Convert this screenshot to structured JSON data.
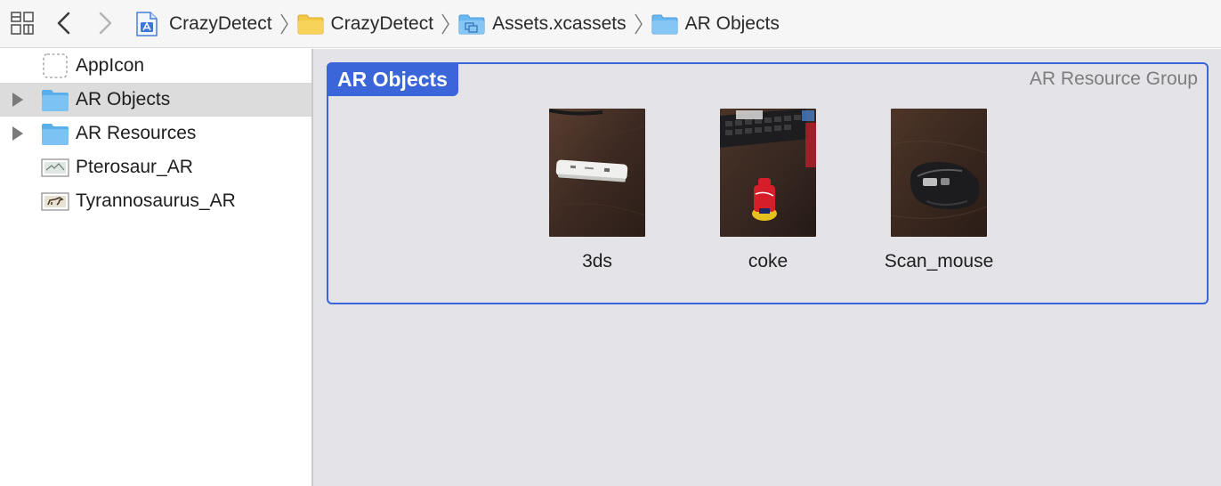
{
  "jumpbar": {
    "breadcrumbs": [
      {
        "label": "CrazyDetect",
        "icon": "xcode-project-icon"
      },
      {
        "label": "CrazyDetect",
        "icon": "folder-icon"
      },
      {
        "label": "Assets.xcassets",
        "icon": "asset-catalog-icon"
      },
      {
        "label": "AR Objects",
        "icon": "folder-icon"
      }
    ]
  },
  "sidebar": {
    "items": [
      {
        "label": "AppIcon",
        "icon": "app-icon-placeholder",
        "expandable": false,
        "selected": false
      },
      {
        "label": "AR Objects",
        "icon": "folder-icon",
        "expandable": true,
        "selected": true
      },
      {
        "label": "AR Resources",
        "icon": "folder-icon",
        "expandable": true,
        "selected": false
      },
      {
        "label": "Pterosaur_AR",
        "icon": "image-asset-icon",
        "expandable": false,
        "selected": false
      },
      {
        "label": "Tyrannosaurus_AR",
        "icon": "image-asset-icon",
        "expandable": false,
        "selected": false
      }
    ]
  },
  "main": {
    "group": {
      "title": "AR Objects",
      "type_label": "AR Resource Group",
      "assets": [
        {
          "name": "3ds",
          "thumbnail": "photo-white-device-on-desk"
        },
        {
          "name": "coke",
          "thumbnail": "photo-coke-bottle-by-keyboard"
        },
        {
          "name": "Scan_mouse",
          "thumbnail": "photo-black-mouse-on-desk"
        }
      ]
    }
  },
  "colors": {
    "accent": "#3a66d9",
    "folder": "#6ab8f0",
    "yellow_folder": "#f4c945",
    "selection": "#dcdcdc",
    "canvas": "#e3e3e8"
  }
}
